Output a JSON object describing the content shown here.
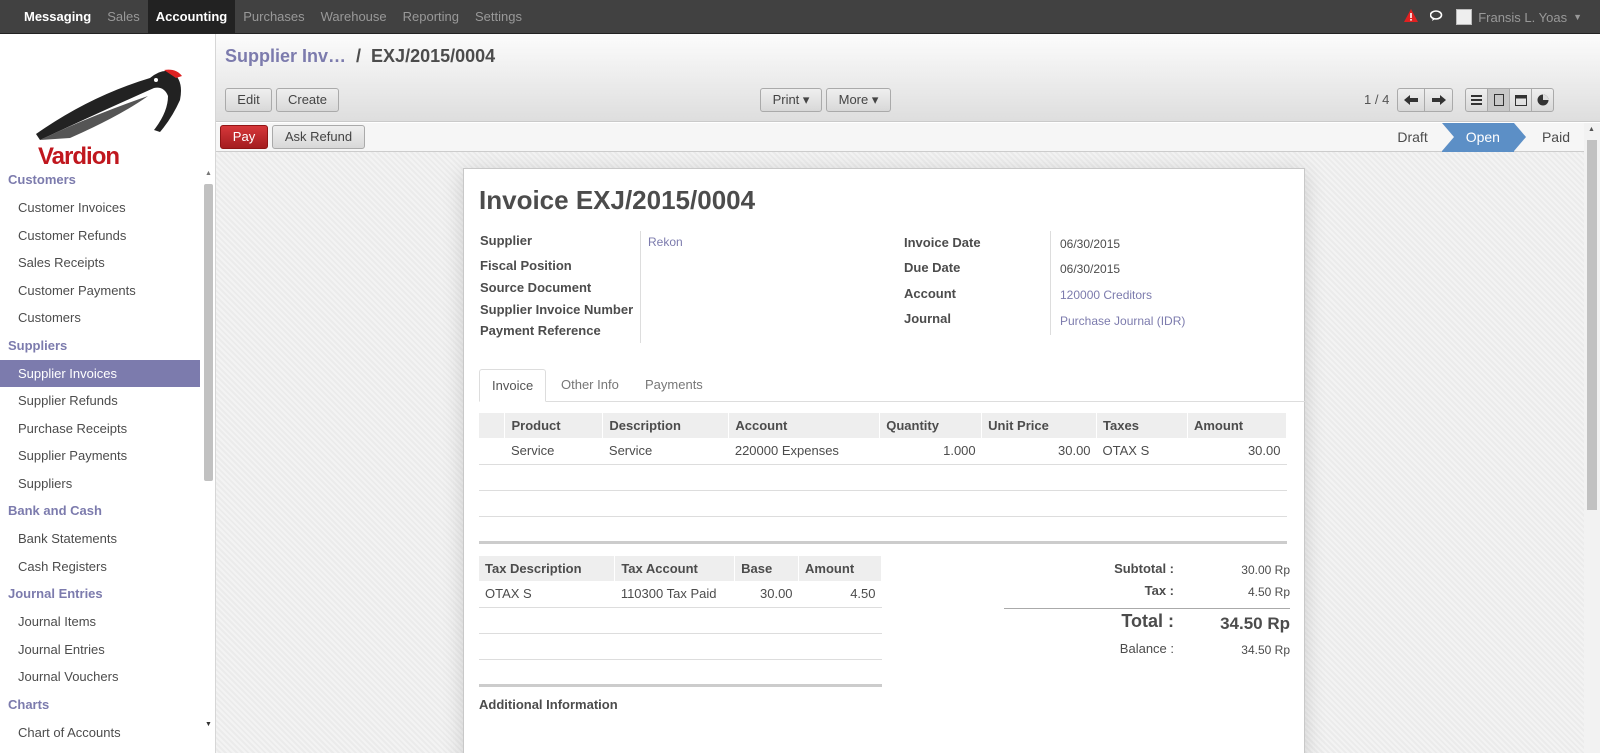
{
  "topbar": {
    "menu": [
      "Messaging",
      "Sales",
      "Accounting",
      "Purchases",
      "Warehouse",
      "Reporting",
      "Settings"
    ],
    "user": "Fransis L. Yoas"
  },
  "brand": {
    "logo_text": "Vardion"
  },
  "sidebar": {
    "groups": [
      {
        "title": "Customers",
        "items": [
          "Customer Invoices",
          "Customer Refunds",
          "Sales Receipts",
          "Customer Payments",
          "Customers"
        ]
      },
      {
        "title": "Suppliers",
        "items": [
          "Supplier Invoices",
          "Supplier Refunds",
          "Purchase Receipts",
          "Supplier Payments",
          "Suppliers"
        ]
      },
      {
        "title": "Bank and Cash",
        "items": [
          "Bank Statements",
          "Cash Registers"
        ]
      },
      {
        "title": "Journal Entries",
        "items": [
          "Journal Items",
          "Journal Entries",
          "Journal Vouchers"
        ]
      },
      {
        "title": "Charts",
        "items": [
          "Chart of Accounts"
        ]
      }
    ],
    "active_item": "Supplier Invoices"
  },
  "breadcrumb": {
    "parent": "Supplier Inv…",
    "separator": "/",
    "current": "EXJ/2015/0004"
  },
  "buttons": {
    "edit": "Edit",
    "create": "Create",
    "print": "Print ▾",
    "more": "More ▾",
    "pay": "Pay",
    "ask_refund": "Ask Refund"
  },
  "pager": {
    "text": "1 / 4"
  },
  "states": [
    "Draft",
    "Open",
    "Paid"
  ],
  "active_state": "Open",
  "invoice": {
    "title": "Invoice EXJ/2015/0004",
    "left_fields": [
      {
        "label": "Supplier",
        "value": "Rekon"
      },
      {
        "label": "Fiscal Position",
        "value": ""
      },
      {
        "label": "Source Document",
        "value": ""
      },
      {
        "label": "Supplier Invoice Number",
        "value": ""
      },
      {
        "label": "Payment Reference",
        "value": ""
      }
    ],
    "right_fields": [
      {
        "label": "Invoice Date",
        "value": "06/30/2015"
      },
      {
        "label": "Due Date",
        "value": "06/30/2015"
      },
      {
        "label": "Account",
        "value": "120000 Creditors"
      },
      {
        "label": "Journal",
        "value": "Purchase Journal (IDR)"
      }
    ],
    "tabs": [
      "Invoice",
      "Other Info",
      "Payments"
    ],
    "lines_headers": [
      "Product",
      "Description",
      "Account",
      "Quantity",
      "Unit Price",
      "Taxes",
      "Amount"
    ],
    "lines": [
      {
        "product": "Service",
        "description": "Service",
        "account": "220000 Expenses",
        "quantity": "1.000",
        "unit_price": "30.00",
        "taxes": "OTAX S",
        "amount": "30.00"
      }
    ],
    "tax_headers": [
      "Tax Description",
      "Tax Account",
      "Base",
      "Amount"
    ],
    "tax_lines": [
      {
        "description": "OTAX S",
        "account": "110300 Tax Paid",
        "base": "30.00",
        "amount": "4.50"
      }
    ],
    "totals": {
      "subtotal_label": "Subtotal :",
      "subtotal": "30.00 Rp",
      "tax_label": "Tax :",
      "tax": "4.50 Rp",
      "total_label": "Total :",
      "total": "34.50 Rp",
      "balance_label": "Balance :",
      "balance": "34.50 Rp"
    },
    "additional_info_label": "Additional Information"
  }
}
